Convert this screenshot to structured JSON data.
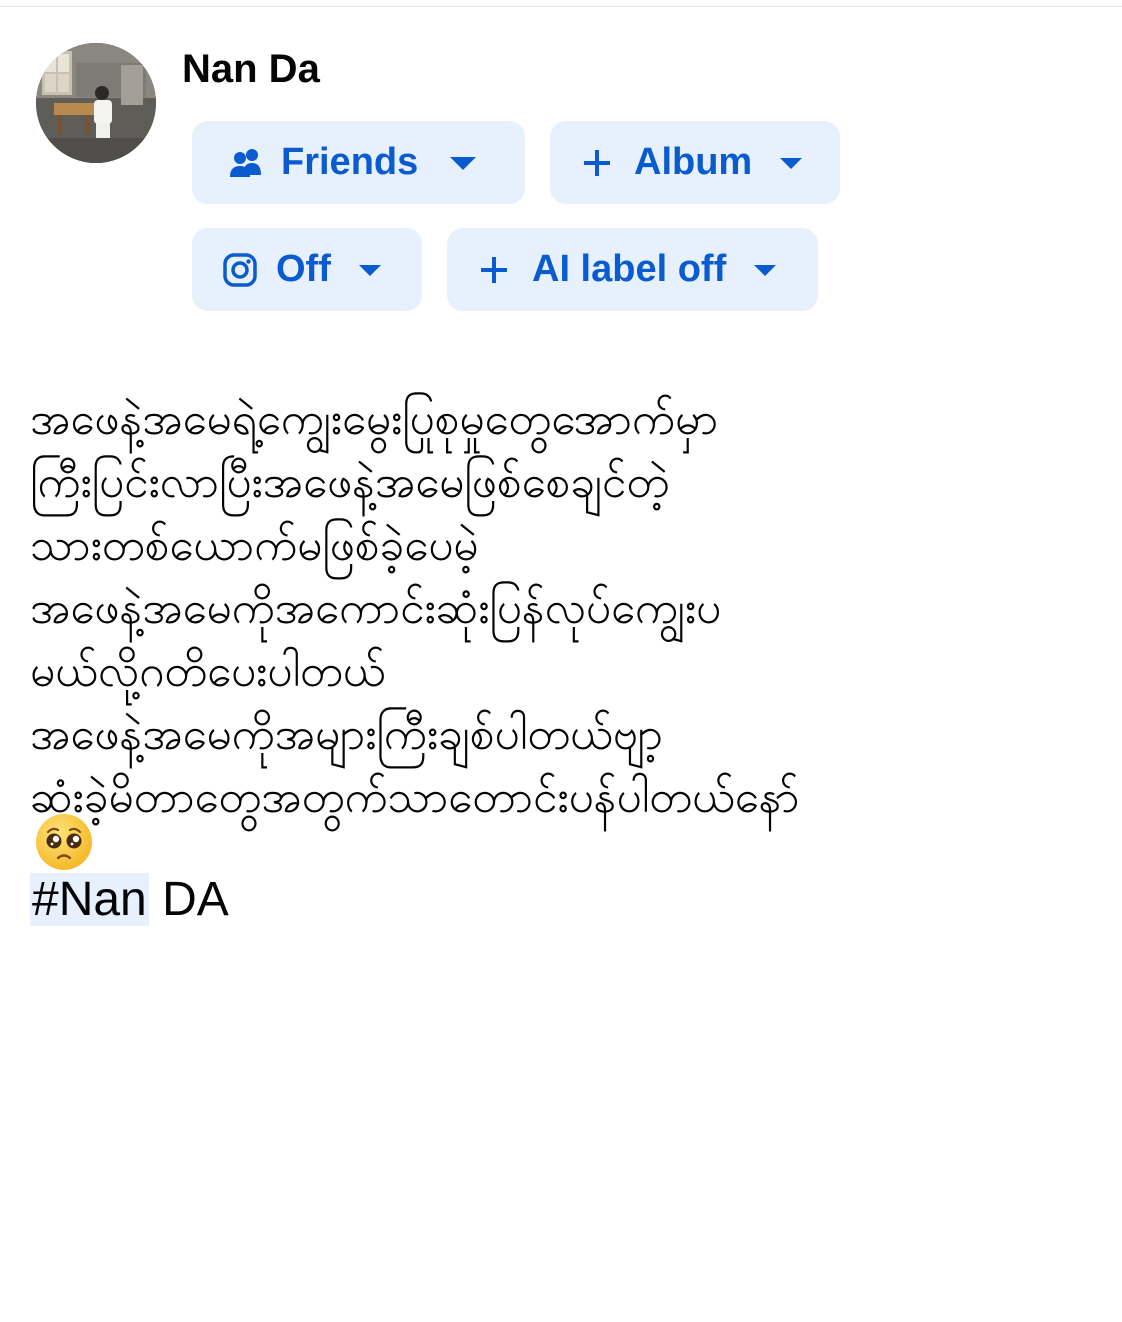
{
  "author": {
    "name": "Nan Da"
  },
  "audience_chips": [
    {
      "id": "friends",
      "icon": "friends-icon",
      "label": "Friends"
    },
    {
      "id": "album",
      "icon": "plus-icon",
      "label": "Album"
    },
    {
      "id": "instagram",
      "icon": "instagram-icon",
      "label": "Off"
    },
    {
      "id": "ai-label",
      "icon": "plus-icon",
      "label": "AI label off"
    }
  ],
  "post": {
    "lines": [
      "အဖေနဲ့အမေရဲ့ကျွေးမွေးပြုစုမှုတွေအောက်မှာ",
      "ကြီးပြင်းလာပြီးအဖေနဲ့အမေဖြစ်စေချင်တဲ့",
      "သားတစ်ယောက်မဖြစ်ခဲ့ပေမဲ့",
      "အဖေနဲ့အမေကိုအကောင်းဆုံးပြန်လုပ်ကျွေးပ",
      "မယ်လို့ဂတိပေးပါတယ်",
      "အဖေနဲ့အမေကိုအများကြီးချစ်ပါတယ်ဗျာ့",
      "ဆုံးခဲ့မိတာတွေအတွက်သာတောင်းပန်ပါတယ်နော်"
    ],
    "emoji": "pleading-face-emoji",
    "hashtag": "#Nan",
    "hashtag_rest": " DA"
  },
  "colors": {
    "chip_bg": "#e7f0fd",
    "chip_text": "#0a5bd0",
    "text": "#050505"
  }
}
